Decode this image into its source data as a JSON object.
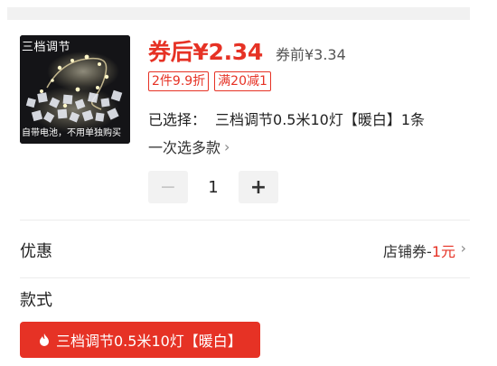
{
  "product": {
    "thumb_tag": "三档调节",
    "thumb_caption": "自带电池，不用单独购买",
    "price_after": "券后¥2.34",
    "price_before": "券前¥3.34",
    "promos": [
      "2件9.9折",
      "满20减1"
    ],
    "selected_label": "已选择：",
    "selected_value": "三档调节0.5米10灯【暖白】1条",
    "multi_select": "一次选多款"
  },
  "quantity": {
    "minus": "−",
    "value": "1",
    "plus": "+"
  },
  "discount": {
    "label": "优惠",
    "coupon_prefix": "店铺券-",
    "coupon_amount": "1元"
  },
  "style": {
    "label": "款式",
    "option": "三档调节0.5米10灯【暖白】"
  },
  "colors": {
    "accent": "#e63225",
    "divider": "#ececec",
    "stepper_bg": "#f2f2f2"
  },
  "icons": {
    "chevron": "chevron-right-icon",
    "fire": "fire-icon"
  }
}
